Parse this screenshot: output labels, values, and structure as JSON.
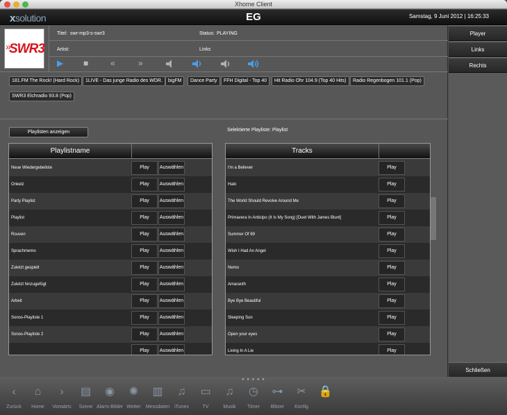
{
  "window": {
    "title": "Xhome Client"
  },
  "header": {
    "logo_x": "x",
    "logo_rest": "solution",
    "app_name": "EG",
    "datetime": "Samstag, 9 Juni 2012  |  16:25:33"
  },
  "player": {
    "logo_text": "SWR3",
    "titel_label": "Titel:",
    "titel_value": "swr-mp3-s-swr3",
    "status_label": "Status:",
    "status_value": "PLAYING",
    "artist_label": "Artist:",
    "zone": "Links"
  },
  "stations": [
    "181.FM The Rock! (Hard Rock)",
    "1LIVE - Das junge Radio des WDR.",
    "bigFM",
    "Dance Party",
    "FFH Digital - Top 40",
    "Hit Radio Ohr 104.9 (Top 40 Hits)",
    "Radio Regenbogen 101.1 (Pop)",
    "SWR3 Elchradio 93.8 (Pop)"
  ],
  "playlists_button": "Playlisten anzeigen",
  "selected_playlist": "Selektierte Playliste: Playlist",
  "playlist_table": {
    "header": "Playlistname",
    "play_label": "Play",
    "select_label": "Auswählen",
    "rows": [
      "Neue Wiedergebeliste",
      "Onkelz",
      "Party Playlist",
      "Playlist",
      "Rouven",
      "Sprachmemo",
      "Zuletzt gespielt",
      "Zuletzt hinzugefügt",
      "Arbeit",
      "Sonos-Playliste  1",
      "Sonos-Playliste  2",
      ""
    ]
  },
  "tracks_table": {
    "header": "Tracks",
    "play_label": "Play",
    "rows": [
      "I'm a Believer",
      "Halo",
      "The World Should Revolve Around Me",
      "Primavera In Anticipo (It Is My Song) [Duet With James Blunt]",
      "Summer Of 69",
      "Wish I Had An Angel",
      "Nemo",
      "Amaranth",
      "Bye Bye Beautiful",
      "Sleeping Sun",
      "Open your eyes",
      "Living In A Lie"
    ]
  },
  "right_panel": {
    "player": "Player",
    "links": "Links",
    "rechts": "Rechts",
    "close": "Schließen"
  },
  "dock": {
    "pager": "● ● ● ● ●",
    "items": [
      {
        "label": "Zurück",
        "icon": "back-arrow-icon"
      },
      {
        "label": "Home",
        "icon": "home-icon"
      },
      {
        "label": "Vorwärts",
        "icon": "forward-arrow-icon"
      },
      {
        "label": "Szene",
        "icon": "clapperboard-icon"
      },
      {
        "label": "Alarm Bilder",
        "icon": "camera-icon"
      },
      {
        "label": "Wetter",
        "icon": "sun-icon"
      },
      {
        "label": "Messdaten",
        "icon": "bar-chart-icon"
      },
      {
        "label": "iTunes",
        "icon": "music-note-icon"
      },
      {
        "label": "TV",
        "icon": "tv-icon"
      },
      {
        "label": "Musik",
        "icon": "music-note-icon"
      },
      {
        "label": "Timer",
        "icon": "clock-icon"
      },
      {
        "label": "Blitzer",
        "icon": "speed-camera-icon"
      },
      {
        "label": "Konfig",
        "icon": "tools-icon"
      },
      {
        "label": "",
        "icon": "lock-icon"
      }
    ]
  }
}
